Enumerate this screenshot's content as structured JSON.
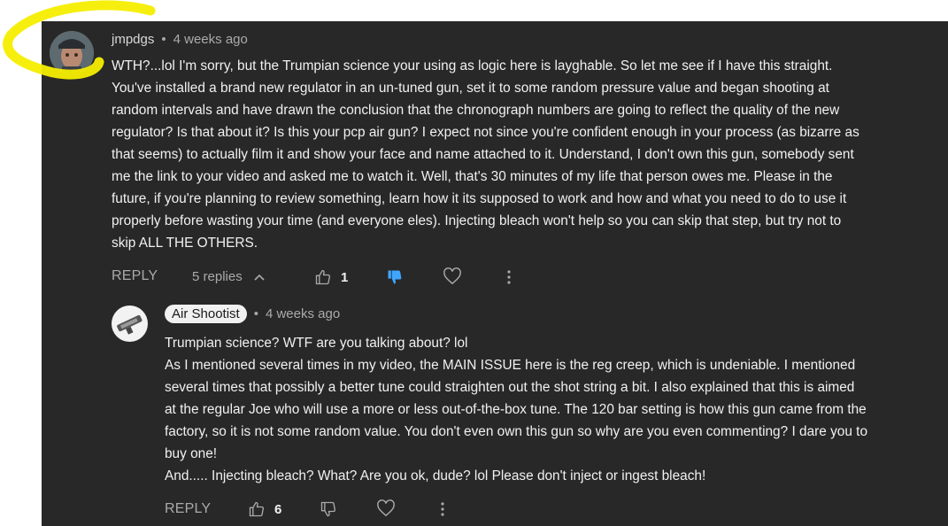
{
  "comment": {
    "author": "jmpdgs",
    "separator": "•",
    "time": "4 weeks ago",
    "text": "WTH?...lol I'm sorry, but the Trumpian science your using as logic here is layghable. So let me see if I have this straight.\nYou've installed a brand new regulator in an un-tuned gun, set it to some random pressure value and began shooting at\nrandom intervals and have drawn the conclusion that the chronograph numbers are going to reflect the quality of the new\nregulator? Is that about it? Is this your pcp air gun? I expect not since you're confident enough in your process (as bizarre as\nthat seems) to actually film it and show your face and name attached to it. Understand, I don't own this gun, somebody sent\nme the link to your video and asked me to watch it. Well, that's 30 minutes of my life that person owes me. Please in the\nfuture, if you're planning to review something, learn how it its supposed to work and how and what you need to do to use it\nproperly before wasting your time (and everyone eles). Injecting bleach won't  help so you can skip that step, but try not to\nskip ALL THE OTHERS.",
    "reply_label": "REPLY",
    "replies_label": "5 replies",
    "like_count": "1",
    "disliked": true
  },
  "reply": {
    "author": "Air Shootist",
    "separator": "•",
    "time": "4 weeks ago",
    "text": "Trumpian science? WTF are you talking about? lol\nAs I mentioned several times in my video, the MAIN ISSUE here is the reg creep, which is undeniable. I mentioned\nseveral times that possibly a better tune could straighten out the shot string a bit. I also explained that this is aimed\nat the regular Joe who will use a more or less out-of-the-box tune. The 120 bar setting is how this gun came from the\nfactory, so it is not some random value.  You don't even own this gun so why are you even commenting? I dare you to\nbuy one!\nAnd..... Injecting bleach? What? Are you ok, dude? lol Please don't inject or ingest bleach!",
    "reply_label": "REPLY",
    "like_count": "6"
  },
  "colors": {
    "panel": "#282828",
    "dislike_active": "#3ea6ff",
    "highlight": "#f5ee00"
  }
}
